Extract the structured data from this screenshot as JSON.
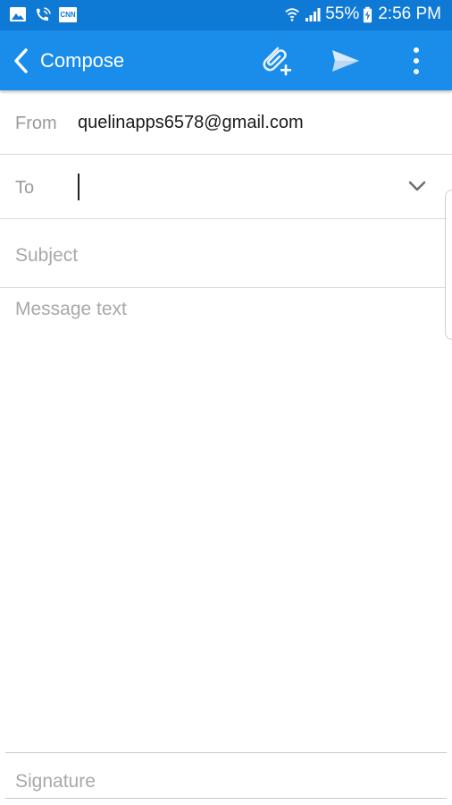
{
  "status_bar": {
    "left_icons": [
      "image-icon",
      "wifi-calling-icon",
      "cnn-icon"
    ],
    "cnn_label": "CNN",
    "right_icons": [
      "wifi-icon",
      "signal-icon",
      "battery-charging-icon"
    ],
    "battery": "55%",
    "time": "2:56 PM"
  },
  "app_bar": {
    "title": "Compose",
    "back_icon": "chevron-left-icon",
    "attach_icon": "attach-add-icon",
    "send_icon": "send-icon",
    "more_icon": "more-vert-icon",
    "color": "#1a8cea",
    "status_color": "#0f7ad6"
  },
  "form": {
    "from_label": "From",
    "from_value": "quelinapps6578@gmail.com",
    "to_label": "To",
    "to_value": "",
    "subject_placeholder": "Subject",
    "message_placeholder": "Message text",
    "signature_placeholder": "Signature"
  }
}
